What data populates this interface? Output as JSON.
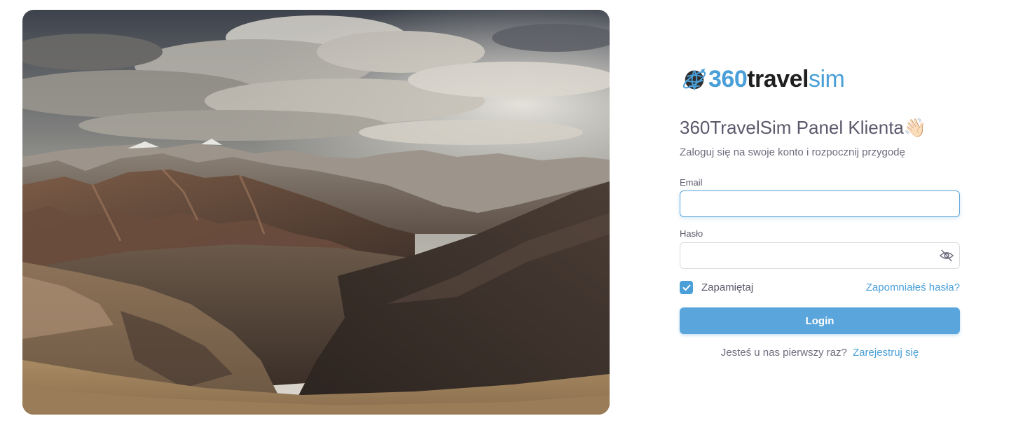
{
  "brand": {
    "logo_number": "360",
    "logo_middle": "travel",
    "logo_end": "sim",
    "logo_icon": "globe-plane-icon"
  },
  "hero": {
    "icon": "mountain-landscape-image"
  },
  "login": {
    "title": "360TravelSim Panel Klienta",
    "title_emoji": "👋🏻",
    "subtitle": "Zaloguj się na swoje konto i rozpocznij przygodę",
    "email_label": "Email",
    "email_value": "",
    "password_label": "Hasło",
    "password_value": "",
    "password_toggle_icon": "eye-off-icon",
    "remember_label": "Zapamiętaj",
    "remember_checked": true,
    "forgot_link": "Zapomniałeś hasła?",
    "login_button": "Login",
    "signup_question": "Jesteś u nas pierwszy raz?",
    "signup_link": "Zarejestruj się"
  },
  "colors": {
    "accent": "#4a9fd8",
    "button": "#5aa6dc",
    "text": "#5d596c",
    "muted": "#6f6b7d"
  }
}
